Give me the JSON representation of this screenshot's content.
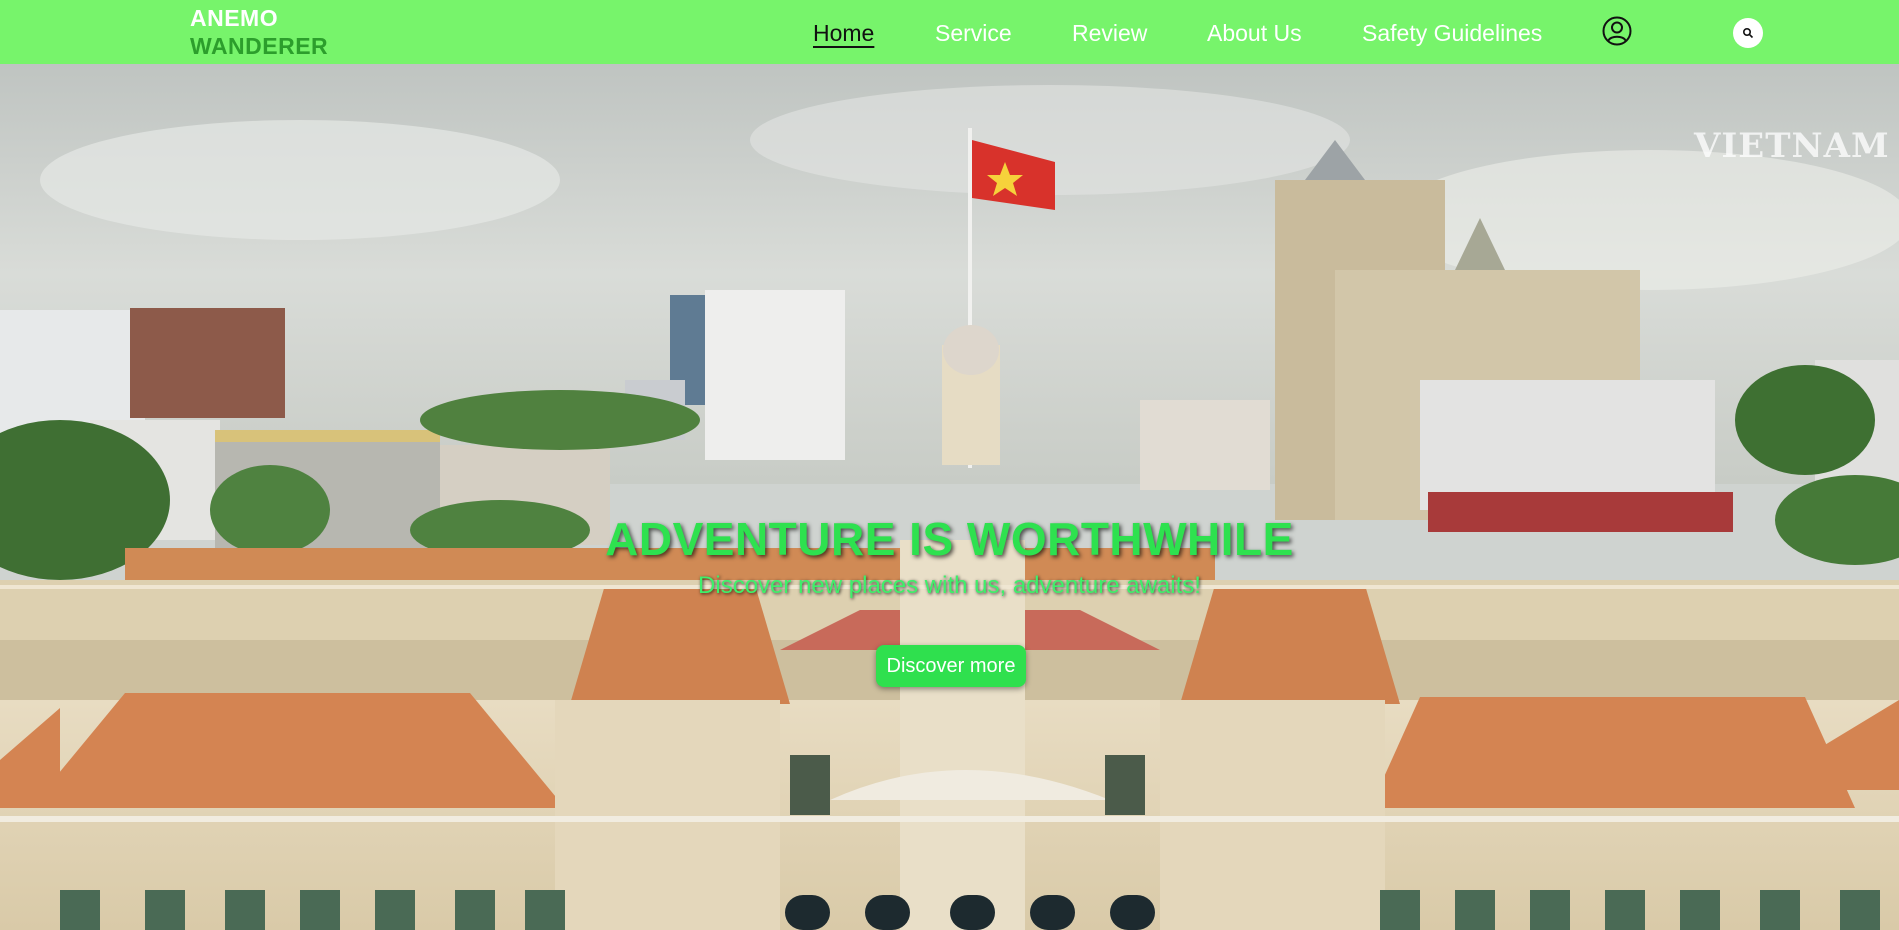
{
  "brand": {
    "line1": "ANEMO",
    "line2": "WANDERER"
  },
  "nav": {
    "items": [
      {
        "label": "Home",
        "active": true
      },
      {
        "label": "Service"
      },
      {
        "label": "Review"
      },
      {
        "label": "About Us"
      },
      {
        "label": "Safety Guidelines"
      }
    ],
    "user_icon": "user-circle-icon",
    "search_icon": "search-icon"
  },
  "hero": {
    "watermark": "VIETNAM",
    "title": "ADVENTURE IS WORTHWHILE",
    "subtitle": "Discover new places with us, adventure awaits!",
    "cta_label": "Discover more"
  },
  "colors": {
    "nav_bg": "#77f46b",
    "brand_secondary": "#2c9e2c",
    "accent": "#2fe04e"
  }
}
